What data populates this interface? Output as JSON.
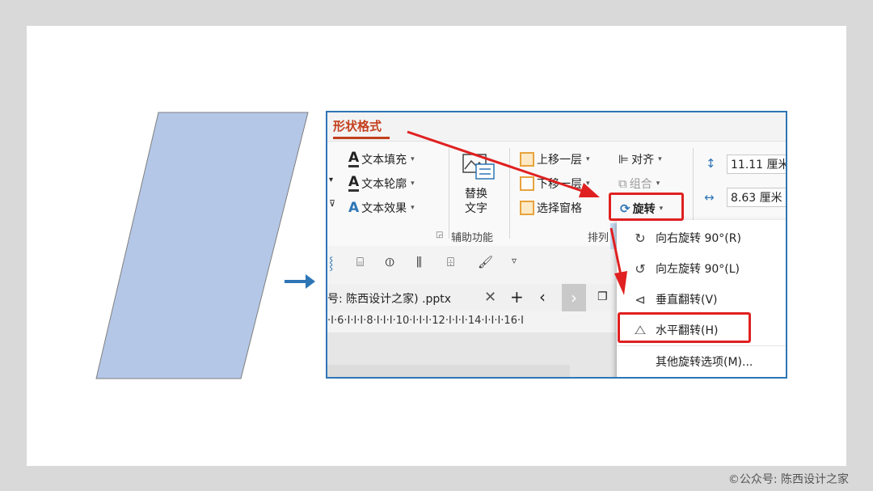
{
  "ribbon": {
    "tab_label": "形状格式",
    "text_fill": "文本填充",
    "text_outline": "文本轮廓",
    "text_effect": "文本效果",
    "alt_text_line1": "替换",
    "alt_text_line2": "文字",
    "accessibility_group": "辅助功能",
    "bring_forward": "上移一层",
    "send_backward": "下移一层",
    "selection_pane": "选择窗格",
    "align": "对齐",
    "group": "组合",
    "rotate": "旋转",
    "arrange_group": "排列",
    "height_value": "11.11 厘米",
    "width_value": "8.63 厘米"
  },
  "filebar": {
    "filename": "号: 陈西设计之家) .pptx"
  },
  "ruler": {
    "text": "·I·6·I·I·I·8·I·I·I·10·I·I·I·12·I·I·I·14·I·I·I·16·I"
  },
  "rotate_menu": {
    "items": [
      {
        "icon": "rotate-right-90-icon",
        "label": "向右旋转 90°(R)"
      },
      {
        "icon": "rotate-left-90-icon",
        "label": "向左旋转 90°(L)"
      },
      {
        "icon": "flip-vertical-icon",
        "label": "垂直翻转(V)"
      },
      {
        "icon": "flip-horizontal-icon",
        "label": "水平翻转(H)"
      },
      {
        "icon": "",
        "label": "其他旋转选项(M)..."
      }
    ]
  },
  "footer": "©公众号: 陈西设计之家",
  "colors": {
    "highlight": "#e02020",
    "parallelogram_fill": "#b4c7e7",
    "arrow_blue": "#2e75b6",
    "tab_red": "#c43e1c"
  }
}
